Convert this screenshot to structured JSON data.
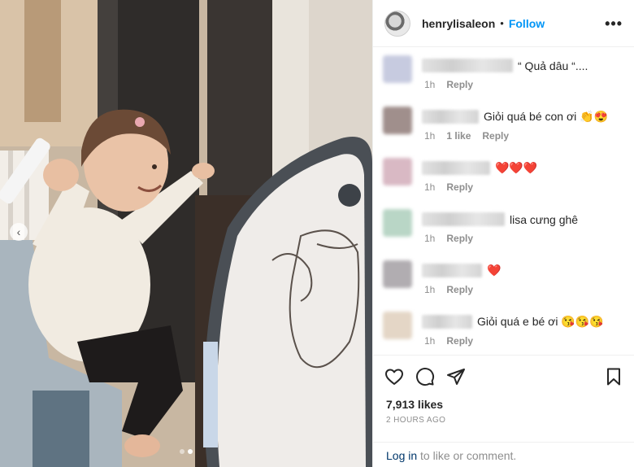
{
  "post": {
    "username": "henrylisaleon",
    "separator": "•",
    "follow_label": "Follow",
    "more_label": "•••",
    "likes": "7,913 likes",
    "time": "2 HOURS AGO",
    "login_link": "Log in",
    "login_rest": " to like or comment."
  },
  "carousel": {
    "prev_label": "‹",
    "slides_total": 2,
    "active_slide": 2
  },
  "comments": [
    {
      "text": "“ Quả dâu “....",
      "time": "1h",
      "likes": "",
      "reply": "Reply",
      "avatar_color": "#c7cbe0",
      "name_width": 112
    },
    {
      "text": "Giỏi quá bé con ơi 👏😍",
      "time": "1h",
      "likes": "1 like",
      "reply": "Reply",
      "avatar_color": "#a08f8c",
      "name_width": 70
    },
    {
      "text": "❤️❤️❤️",
      "time": "1h",
      "likes": "",
      "reply": "Reply",
      "avatar_color": "#d9b9c4",
      "name_width": 84
    },
    {
      "text": "lisa cưng ghê",
      "time": "1h",
      "likes": "",
      "reply": "Reply",
      "avatar_color": "#b9d6c6",
      "name_width": 102
    },
    {
      "text": "❤️",
      "time": "1h",
      "likes": "",
      "reply": "Reply",
      "avatar_color": "#b1adb1",
      "name_width": 74
    },
    {
      "text": "Giỏi quá e bé ơi 😘😘😘",
      "time": "1h",
      "likes": "",
      "reply": "Reply",
      "avatar_color": "#e4d6c6",
      "name_width": 62
    }
  ],
  "colors": {
    "accent": "#0095f6",
    "link": "#00376b",
    "muted": "#8e8e8e",
    "text": "#262626"
  },
  "icons": [
    "heart-icon",
    "comment-icon",
    "share-icon",
    "bookmark-icon",
    "more-options-icon"
  ]
}
